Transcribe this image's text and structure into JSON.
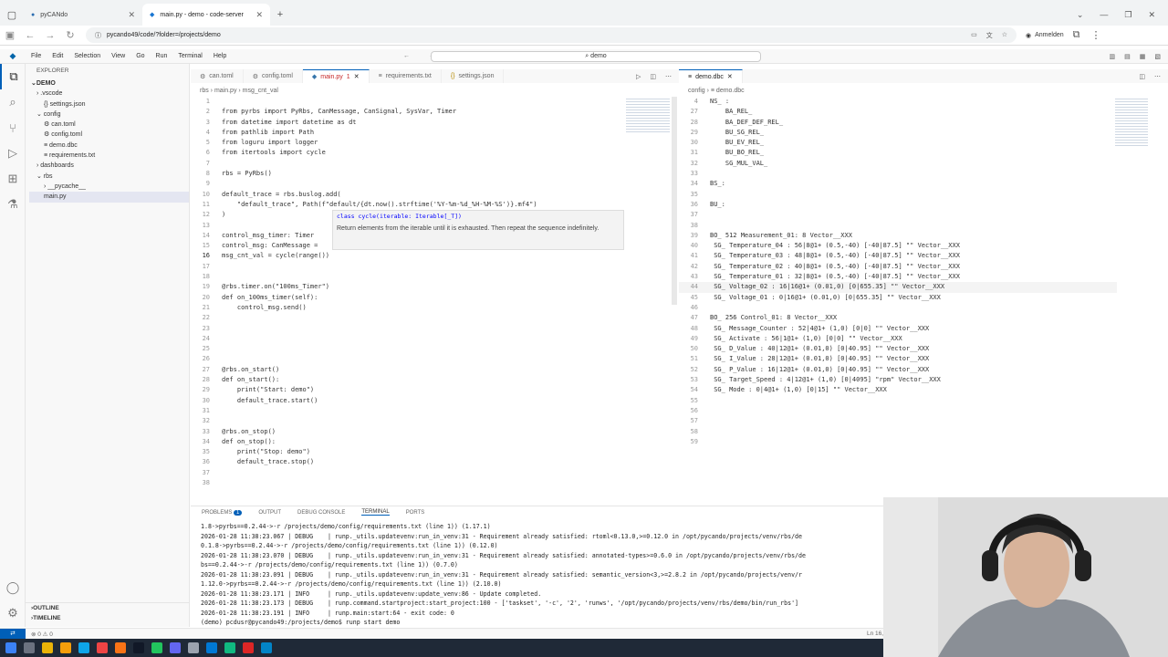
{
  "browser": {
    "tabs": [
      {
        "label": "pyCANdo",
        "active": false
      },
      {
        "label": "main.py - demo - code-server",
        "active": true
      }
    ],
    "url": "pycando49/code/?folder=/projects/demo",
    "profile_label": "Anmelden"
  },
  "vscode": {
    "menu": [
      "File",
      "Edit",
      "Selection",
      "View",
      "Go",
      "Run",
      "Terminal",
      "Help"
    ],
    "command_center": "demo"
  },
  "sidebar": {
    "title": "EXPLORER",
    "root": "DEMO",
    "items": [
      {
        "label": "› .vscode",
        "indent": 1
      },
      {
        "label": "{} settings.json",
        "indent": 2
      },
      {
        "label": "⌄ config",
        "indent": 1
      },
      {
        "label": "⚙ can.toml",
        "indent": 2
      },
      {
        "label": "⚙ config.toml",
        "indent": 2
      },
      {
        "label": "≡ demo.dbc",
        "indent": 2
      },
      {
        "label": "≡ requirements.txt",
        "indent": 2
      },
      {
        "label": "› dashboards",
        "indent": 1
      },
      {
        "label": "⌄ rbs",
        "indent": 1
      },
      {
        "label": "› __pycache__",
        "indent": 2
      },
      {
        "label": "main.py",
        "indent": 2
      }
    ],
    "outline": "OUTLINE",
    "timeline": "TIMELINE"
  },
  "editor": {
    "tabs": [
      "can.toml",
      "config.toml",
      "main.py",
      "requirements.txt",
      "settings.json"
    ],
    "active_tab_badge": "1",
    "breadcrumb": "rbs  ›  main.py  ›  msg_cnt_val",
    "lines": [
      {
        "n": "1",
        "t": ""
      },
      {
        "n": "2",
        "t": "from pyrbs import PyRbs, CanMessage, CanSignal, SysVar, Timer"
      },
      {
        "n": "3",
        "t": "from datetime import datetime as dt"
      },
      {
        "n": "4",
        "t": "from pathlib import Path"
      },
      {
        "n": "5",
        "t": "from loguru import logger"
      },
      {
        "n": "6",
        "t": "from itertools import cycle"
      },
      {
        "n": "7",
        "t": ""
      },
      {
        "n": "8",
        "t": "rbs = PyRbs()"
      },
      {
        "n": "9",
        "t": ""
      },
      {
        "n": "10",
        "t": "default_trace = rbs.buslog.add("
      },
      {
        "n": "11",
        "t": "    \"default_trace\", Path(f\"default/{dt.now().strftime('%Y-%m-%d_%H-%M-%S')}.mf4\")"
      },
      {
        "n": "12",
        "t": ")"
      },
      {
        "n": "13",
        "t": ""
      },
      {
        "n": "14",
        "t": "control_msg_timer: Timer"
      },
      {
        "n": "15",
        "t": "control_msg: CanMessage ="
      },
      {
        "n": "16",
        "t": "msg_cnt_val = cycle(range())"
      },
      {
        "n": "17",
        "t": ""
      },
      {
        "n": "18",
        "t": ""
      },
      {
        "n": "19",
        "t": "@rbs.timer.on(\"100ms_Timer\")"
      },
      {
        "n": "20",
        "t": "def on_100ms_timer(self):"
      },
      {
        "n": "21",
        "t": "    control_msg.send()"
      },
      {
        "n": "22",
        "t": ""
      },
      {
        "n": "23",
        "t": ""
      },
      {
        "n": "24",
        "t": ""
      },
      {
        "n": "25",
        "t": ""
      },
      {
        "n": "26",
        "t": ""
      },
      {
        "n": "27",
        "t": "@rbs.on_start()"
      },
      {
        "n": "28",
        "t": "def on_start():"
      },
      {
        "n": "29",
        "t": "    print(\"Start: demo\")"
      },
      {
        "n": "30",
        "t": "    default_trace.start()"
      },
      {
        "n": "31",
        "t": ""
      },
      {
        "n": "32",
        "t": ""
      },
      {
        "n": "33",
        "t": "@rbs.on_stop()"
      },
      {
        "n": "34",
        "t": "def on_stop():"
      },
      {
        "n": "35",
        "t": "    print(\"Stop: demo\")"
      },
      {
        "n": "36",
        "t": "    default_trace.stop()"
      },
      {
        "n": "37",
        "t": ""
      },
      {
        "n": "38",
        "t": ""
      }
    ],
    "hover_signature": "class cycle(iterable: Iterable[_T])",
    "hover_doc": "Return elements from the iterable until it is exhausted. Then repeat the sequence indefinitely."
  },
  "dbc_editor": {
    "tab": "demo.dbc",
    "breadcrumb": "config  ›  ≡ demo.dbc",
    "lines": [
      {
        "n": "4",
        "t": "NS_ :"
      },
      {
        "n": "27",
        "t": "    BA_REL_"
      },
      {
        "n": "28",
        "t": "    BA_DEF_DEF_REL_"
      },
      {
        "n": "29",
        "t": "    BU_SG_REL_"
      },
      {
        "n": "30",
        "t": "    BU_EV_REL_"
      },
      {
        "n": "31",
        "t": "    BU_BO_REL_"
      },
      {
        "n": "32",
        "t": "    SG_MUL_VAL_"
      },
      {
        "n": "33",
        "t": ""
      },
      {
        "n": "34",
        "t": "BS_:"
      },
      {
        "n": "35",
        "t": ""
      },
      {
        "n": "36",
        "t": "BU_:"
      },
      {
        "n": "37",
        "t": ""
      },
      {
        "n": "38",
        "t": ""
      },
      {
        "n": "39",
        "t": "BO_ 512 Measurement_01: 8 Vector__XXX"
      },
      {
        "n": "40",
        "t": " SG_ Temperature_04 : 56|8@1+ (0.5,-40) [-40|87.5] \"\" Vector__XXX"
      },
      {
        "n": "41",
        "t": " SG_ Temperature_03 : 48|8@1+ (0.5,-40) [-40|87.5] \"\" Vector__XXX"
      },
      {
        "n": "42",
        "t": " SG_ Temperature_02 : 40|8@1+ (0.5,-40) [-40|87.5] \"\" Vector__XXX"
      },
      {
        "n": "43",
        "t": " SG_ Temperature_01 : 32|8@1+ (0.5,-40) [-40|87.5] \"\" Vector__XXX"
      },
      {
        "n": "44",
        "t": " SG_ Voltage_02 : 16|16@1+ (0.01,0) [0|655.35] \"\" Vector__XXX"
      },
      {
        "n": "45",
        "t": " SG_ Voltage_01 : 0|16@1+ (0.01,0) [0|655.35] \"\" Vector__XXX"
      },
      {
        "n": "46",
        "t": ""
      },
      {
        "n": "47",
        "t": "BO_ 256 Control_01: 8 Vector__XXX"
      },
      {
        "n": "48",
        "t": " SG_ Message_Counter : 52|4@1+ (1,0) [0|0] \"\" Vector__XXX"
      },
      {
        "n": "49",
        "t": " SG_ Activate : 56|1@1+ (1,0) [0|0] \"\" Vector__XXX"
      },
      {
        "n": "50",
        "t": " SG_ D_Value : 40|12@1+ (0.01,0) [0|40.95] \"\" Vector__XXX"
      },
      {
        "n": "51",
        "t": " SG_ I_Value : 28|12@1+ (0.01,0) [0|40.95] \"\" Vector__XXX"
      },
      {
        "n": "52",
        "t": " SG_ P_Value : 16|12@1+ (0.01,0) [0|40.95] \"\" Vector__XXX"
      },
      {
        "n": "53",
        "t": " SG_ Target_Speed : 4|12@1+ (1,0) [0|4095] \"rpm\" Vector__XXX"
      },
      {
        "n": "54",
        "t": " SG_ Mode : 0|4@1+ (1,0) [0|15] \"\" Vector__XXX"
      },
      {
        "n": "55",
        "t": ""
      },
      {
        "n": "56",
        "t": ""
      },
      {
        "n": "57",
        "t": ""
      },
      {
        "n": "58",
        "t": ""
      },
      {
        "n": "59",
        "t": ""
      }
    ]
  },
  "panel": {
    "tabs": [
      "PROBLEMS",
      "OUTPUT",
      "DEBUG CONSOLE",
      "TERMINAL",
      "PORTS"
    ],
    "problems_count": "1",
    "terminal_lines": [
      "1.8->pyrbs==0.2.44->-r /projects/demo/config/requirements.txt (line 1)) (1.17.1)",
      "2026-01-28 11:38:23.067 | DEBUG    | runp._utils.updatevenv:run_in_venv:31 - Requirement already satisfied: rtoml<0.13.0,>=0.12.0 in /opt/pycando/projects/venv/rbs/de",
      "0.1.8->pyrbs==0.2.44->-r /projects/demo/config/requirements.txt (line 1)) (0.12.0)",
      "2026-01-28 11:38:23.070 | DEBUG    | runp._utils.updatevenv:run_in_venv:31 - Requirement already satisfied: annotated-types>=0.6.0 in /opt/pycando/projects/venv/rbs/de",
      "bs==0.2.44->-r /projects/demo/config/requirements.txt (line 1)) (0.7.0)",
      "2026-01-28 11:38:23.091 | DEBUG    | runp._utils.updatevenv:run_in_venv:31 - Requirement already satisfied: semantic_version<3,>=2.8.2 in /opt/pycando/projects/venv/r",
      "1.12.0->pyrbs==0.2.44->-r /projects/demo/config/requirements.txt (line 1)) (2.10.0)",
      "2026-01-28 11:38:23.171 | INFO     | runp._utils.updatevenv:update_venv:86 - Update completed.",
      "2026-01-28 11:38:23.173 | DEBUG    | runp.command.startproject:start_project:100 - ['taskset', '-c', '2', 'runws', '/opt/pycando/projects/venv/rbs/demo/bin/run_rbs']",
      "2026-01-28 11:38:23.191 | INFO     | runp.main:start:64 - exit code: 0",
      "(demo) pcdusr@pycando49:/projects/demo$ runp start demo"
    ]
  },
  "status": {
    "left": "⊗ 0 ⚠ 0",
    "right": "Ln 16,"
  }
}
